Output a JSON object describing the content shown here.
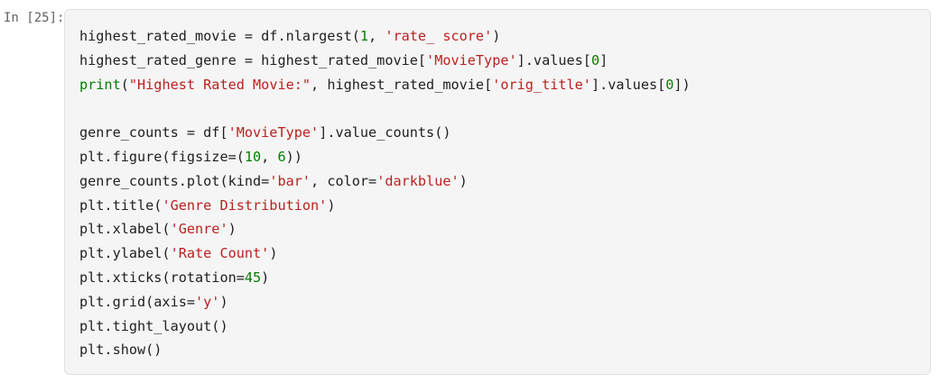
{
  "cell": {
    "prompt": "In [25]:",
    "lines": [
      [
        {
          "t": "highest_rated_movie = df.nlargest(",
          "k": "name"
        },
        {
          "t": "1",
          "k": "num"
        },
        {
          "t": ", ",
          "k": "name"
        },
        {
          "t": "'rate_ score'",
          "k": "str"
        },
        {
          "t": ")",
          "k": "name"
        }
      ],
      [
        {
          "t": "highest_rated_genre = highest_rated_movie[",
          "k": "name"
        },
        {
          "t": "'MovieType'",
          "k": "str"
        },
        {
          "t": "].values[",
          "k": "name"
        },
        {
          "t": "0",
          "k": "num"
        },
        {
          "t": "]",
          "k": "name"
        }
      ],
      [
        {
          "t": "print",
          "k": "builtin"
        },
        {
          "t": "(",
          "k": "name"
        },
        {
          "t": "\"Highest Rated Movie:\"",
          "k": "str"
        },
        {
          "t": ", highest_rated_movie[",
          "k": "name"
        },
        {
          "t": "'orig_title'",
          "k": "str"
        },
        {
          "t": "].values[",
          "k": "name"
        },
        {
          "t": "0",
          "k": "num"
        },
        {
          "t": "])",
          "k": "name"
        }
      ],
      [],
      [
        {
          "t": "genre_counts = df[",
          "k": "name"
        },
        {
          "t": "'MovieType'",
          "k": "str"
        },
        {
          "t": "].value_counts()",
          "k": "name"
        }
      ],
      [
        {
          "t": "plt.figure(figsize=(",
          "k": "name"
        },
        {
          "t": "10",
          "k": "num"
        },
        {
          "t": ", ",
          "k": "name"
        },
        {
          "t": "6",
          "k": "num"
        },
        {
          "t": "))",
          "k": "name"
        }
      ],
      [
        {
          "t": "genre_counts.plot(kind=",
          "k": "name"
        },
        {
          "t": "'bar'",
          "k": "str"
        },
        {
          "t": ", color=",
          "k": "name"
        },
        {
          "t": "'darkblue'",
          "k": "str"
        },
        {
          "t": ")",
          "k": "name"
        }
      ],
      [
        {
          "t": "plt.title(",
          "k": "name"
        },
        {
          "t": "'Genre Distribution'",
          "k": "str"
        },
        {
          "t": ")",
          "k": "name"
        }
      ],
      [
        {
          "t": "plt.xlabel(",
          "k": "name"
        },
        {
          "t": "'Genre'",
          "k": "str"
        },
        {
          "t": ")",
          "k": "name"
        }
      ],
      [
        {
          "t": "plt.ylabel(",
          "k": "name"
        },
        {
          "t": "'Rate Count'",
          "k": "str"
        },
        {
          "t": ")",
          "k": "name"
        }
      ],
      [
        {
          "t": "plt.xticks(rotation=",
          "k": "name"
        },
        {
          "t": "45",
          "k": "num"
        },
        {
          "t": ")",
          "k": "name"
        }
      ],
      [
        {
          "t": "plt.grid(axis=",
          "k": "name"
        },
        {
          "t": "'y'",
          "k": "str"
        },
        {
          "t": ")",
          "k": "name"
        }
      ],
      [
        {
          "t": "plt.tight_layout()",
          "k": "name"
        }
      ],
      [
        {
          "t": "plt.show()",
          "k": "name"
        }
      ]
    ]
  },
  "colors": {
    "background": "#ffffff",
    "input_background": "#f5f5f5",
    "input_border": "#e0e0e0",
    "prompt_text": "#616161",
    "code_text": "#212121",
    "string": "#ba2121",
    "number": "#008000",
    "builtin": "#008000"
  }
}
